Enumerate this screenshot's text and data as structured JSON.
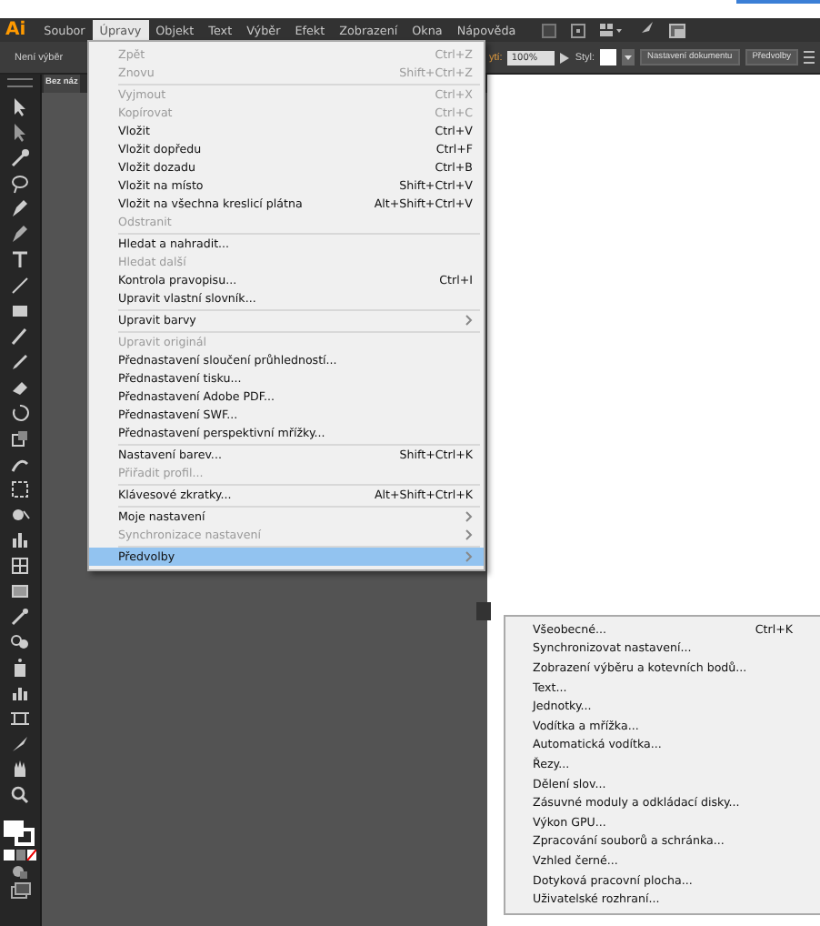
{
  "app_logo": "Ai",
  "menu_bar": {
    "items": [
      {
        "label": "Soubor",
        "selected": false
      },
      {
        "label": "Úpravy",
        "selected": true
      },
      {
        "label": "Objekt",
        "selected": false
      },
      {
        "label": "Text",
        "selected": false
      },
      {
        "label": "Výběr",
        "selected": false
      },
      {
        "label": "Efekt",
        "selected": false
      },
      {
        "label": "Zobrazení",
        "selected": false
      },
      {
        "label": "Okna",
        "selected": false
      },
      {
        "label": "Nápověda",
        "selected": false
      }
    ]
  },
  "control_bar": {
    "selection_label": "Není výběr",
    "opacity_label": "ytí:",
    "opacity_value": "100%",
    "style_label": "Styl:",
    "buttons": [
      "Nastavení dokumentu",
      "Předvolby"
    ]
  },
  "document_tab": {
    "title": "Bez náz"
  },
  "edit_menu": {
    "items": [
      {
        "kind": "item",
        "label": "Zpět",
        "shortcut": "Ctrl+Z",
        "disabled": true,
        "submenu": false,
        "selected": false
      },
      {
        "kind": "item",
        "label": "Znovu",
        "shortcut": "Shift+Ctrl+Z",
        "disabled": true,
        "submenu": false,
        "selected": false
      },
      {
        "kind": "separator"
      },
      {
        "kind": "item",
        "label": "Vyjmout",
        "shortcut": "Ctrl+X",
        "disabled": true,
        "submenu": false,
        "selected": false
      },
      {
        "kind": "item",
        "label": "Kopírovat",
        "shortcut": "Ctrl+C",
        "disabled": true,
        "submenu": false,
        "selected": false
      },
      {
        "kind": "item",
        "label": "Vložit",
        "shortcut": "Ctrl+V",
        "disabled": false,
        "submenu": false,
        "selected": false
      },
      {
        "kind": "item",
        "label": "Vložit dopředu",
        "shortcut": "Ctrl+F",
        "disabled": false,
        "submenu": false,
        "selected": false
      },
      {
        "kind": "item",
        "label": "Vložit dozadu",
        "shortcut": "Ctrl+B",
        "disabled": false,
        "submenu": false,
        "selected": false
      },
      {
        "kind": "item",
        "label": "Vložit na místo",
        "shortcut": "Shift+Ctrl+V",
        "disabled": false,
        "submenu": false,
        "selected": false
      },
      {
        "kind": "item",
        "label": "Vložit na všechna kreslicí plátna",
        "shortcut": "Alt+Shift+Ctrl+V",
        "disabled": false,
        "submenu": false,
        "selected": false
      },
      {
        "kind": "item",
        "label": "Odstranit",
        "disabled": true,
        "submenu": false,
        "selected": false
      },
      {
        "kind": "separator"
      },
      {
        "kind": "item",
        "label": "Hledat a nahradit...",
        "disabled": false,
        "submenu": false,
        "selected": false
      },
      {
        "kind": "item",
        "label": "Hledat další",
        "disabled": true,
        "submenu": false,
        "selected": false
      },
      {
        "kind": "item",
        "label": "Kontrola pravopisu...",
        "shortcut": "Ctrl+I",
        "disabled": false,
        "submenu": false,
        "selected": false
      },
      {
        "kind": "item",
        "label": "Upravit vlastní slovník...",
        "disabled": false,
        "submenu": false,
        "selected": false
      },
      {
        "kind": "separator"
      },
      {
        "kind": "item",
        "label": "Upravit barvy",
        "disabled": false,
        "submenu": true,
        "selected": false
      },
      {
        "kind": "separator"
      },
      {
        "kind": "item",
        "label": "Upravit originál",
        "disabled": true,
        "submenu": false,
        "selected": false
      },
      {
        "kind": "item",
        "label": "Přednastavení sloučení průhledností...",
        "disabled": false,
        "submenu": false,
        "selected": false
      },
      {
        "kind": "item",
        "label": "Přednastavení tisku...",
        "disabled": false,
        "submenu": false,
        "selected": false
      },
      {
        "kind": "item",
        "label": "Přednastavení Adobe PDF...",
        "disabled": false,
        "submenu": false,
        "selected": false
      },
      {
        "kind": "item",
        "label": "Přednastavení SWF...",
        "disabled": false,
        "submenu": false,
        "selected": false
      },
      {
        "kind": "item",
        "label": "Přednastavení perspektivní mřížky...",
        "disabled": false,
        "submenu": false,
        "selected": false
      },
      {
        "kind": "separator"
      },
      {
        "kind": "item",
        "label": "Nastavení barev...",
        "shortcut": "Shift+Ctrl+K",
        "disabled": false,
        "submenu": false,
        "selected": false
      },
      {
        "kind": "item",
        "label": "Přiřadit profil...",
        "disabled": true,
        "submenu": false,
        "selected": false
      },
      {
        "kind": "separator"
      },
      {
        "kind": "item",
        "label": "Klávesové zkratky...",
        "shortcut": "Alt+Shift+Ctrl+K",
        "disabled": false,
        "submenu": false,
        "selected": false
      },
      {
        "kind": "separator"
      },
      {
        "kind": "item",
        "label": "Moje nastavení",
        "disabled": false,
        "submenu": true,
        "selected": false
      },
      {
        "kind": "item",
        "label": "Synchronizace nastavení",
        "disabled": true,
        "submenu": true,
        "selected": false
      },
      {
        "kind": "separator"
      },
      {
        "kind": "item",
        "label": "Předvolby",
        "disabled": false,
        "submenu": true,
        "selected": true
      }
    ]
  },
  "preferences_submenu": {
    "items": [
      {
        "label": "Všeobecné...",
        "shortcut": "Ctrl+K",
        "selected": false
      },
      {
        "label": "Synchronizovat nastavení...",
        "selected": false
      },
      {
        "label": "Zobrazení výběru a kotevních bodů...",
        "selected": false
      },
      {
        "label": "Text...",
        "selected": false
      },
      {
        "label": "Jednotky...",
        "selected": false
      },
      {
        "label": "Vodítka a mřížka...",
        "selected": false
      },
      {
        "label": "Automatická vodítka...",
        "selected": false
      },
      {
        "label": "Řezy...",
        "selected": false
      },
      {
        "label": "Dělení slov...",
        "selected": false
      },
      {
        "label": "Zásuvné moduly a odkládací disky...",
        "selected": false
      },
      {
        "label": "Výkon GPU...",
        "selected": false
      },
      {
        "label": "Zpracování souborů a schránka...",
        "selected": false
      },
      {
        "label": "Vzhled černé...",
        "selected": false
      },
      {
        "label": "Dotyková pracovní plocha...",
        "selected": false
      },
      {
        "label": "Uživatelské rozhraní...",
        "selected": false
      }
    ]
  }
}
